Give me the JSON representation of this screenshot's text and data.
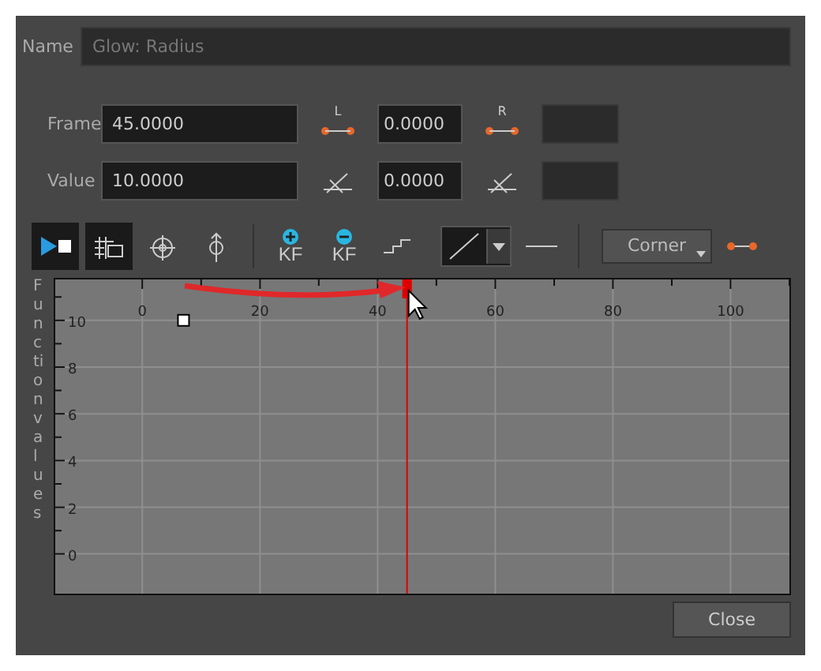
{
  "name_field": {
    "label": "Name",
    "placeholder": "Glow: Radius"
  },
  "rows": [
    {
      "label": "Frame",
      "value": "45.0000",
      "handle_a": {
        "kind": "left",
        "label": "L"
      },
      "field_a": "0.0000",
      "handle_b": {
        "kind": "right",
        "label": "R"
      }
    },
    {
      "label": "Value",
      "value": "10.0000",
      "handle_a": {
        "kind": "angle"
      },
      "field_a": "0.0000",
      "handle_b": {
        "kind": "angle"
      }
    }
  ],
  "toolbar": [
    {
      "kind": "play",
      "selected": true
    },
    {
      "kind": "grid",
      "selected": true
    },
    {
      "kind": "rotate",
      "selected": false
    },
    {
      "kind": "anchor",
      "selected": false
    },
    {
      "kind": "separator"
    },
    {
      "kind": "add-kf",
      "label": "KF"
    },
    {
      "kind": "remove-kf",
      "label": "KF"
    },
    {
      "kind": "step"
    },
    {
      "kind": "linear-dropdown",
      "selected": true
    },
    {
      "kind": "flat"
    },
    {
      "kind": "separator"
    },
    {
      "kind": "dropdown",
      "label": "Corner"
    },
    {
      "kind": "handle"
    }
  ],
  "graph": {
    "axis_label": "Function values",
    "chart_data": {
      "type": "scatter",
      "xlim": [
        -14.8,
        110
      ],
      "ylim": [
        -1.7,
        11.75
      ],
      "xticks": [
        0,
        20,
        40,
        60,
        80,
        100
      ],
      "yticks": [
        0,
        2,
        4,
        6,
        8,
        10
      ],
      "series": [
        {
          "color": "#ffffff",
          "values": [
            10
          ]
        }
      ],
      "x": [
        7
      ],
      "grid": true,
      "ref_lines": [
        {
          "axis": "x",
          "value": 45,
          "color": "#e00000"
        }
      ]
    }
  },
  "buttons": [
    "Close"
  ]
}
